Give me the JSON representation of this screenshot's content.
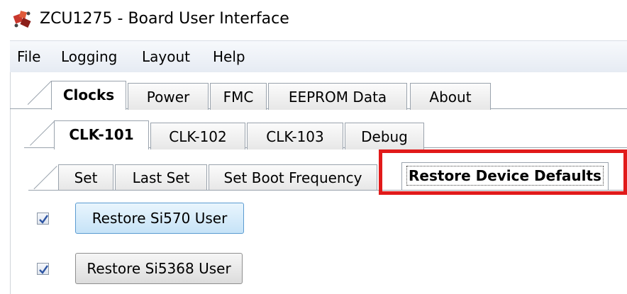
{
  "window": {
    "title": "ZCU1275 - Board User Interface",
    "icon": "board-logo-icon"
  },
  "menu": [
    "File",
    "Logging",
    "Layout",
    "Help"
  ],
  "main_tabs": [
    "Clocks",
    "Power",
    "FMC",
    "EEPROM Data",
    "About"
  ],
  "main_tabs_active": "Clocks",
  "clk_tabs": [
    "CLK-101",
    "CLK-102",
    "CLK-103",
    "Debug"
  ],
  "clk_tabs_active": "CLK-101",
  "sub_tabs": [
    "Set",
    "Last Set",
    "Set Boot Frequency",
    "Restore Device Defaults"
  ],
  "sub_tabs_active": "Restore Device Defaults",
  "rows": [
    {
      "checked": true,
      "button_label": "Restore Si570 User"
    },
    {
      "checked": true,
      "button_label": "Restore Si5368 User"
    }
  ],
  "colors": {
    "highlight": "#e11a1a",
    "primary_button": "#c6e3f7"
  }
}
